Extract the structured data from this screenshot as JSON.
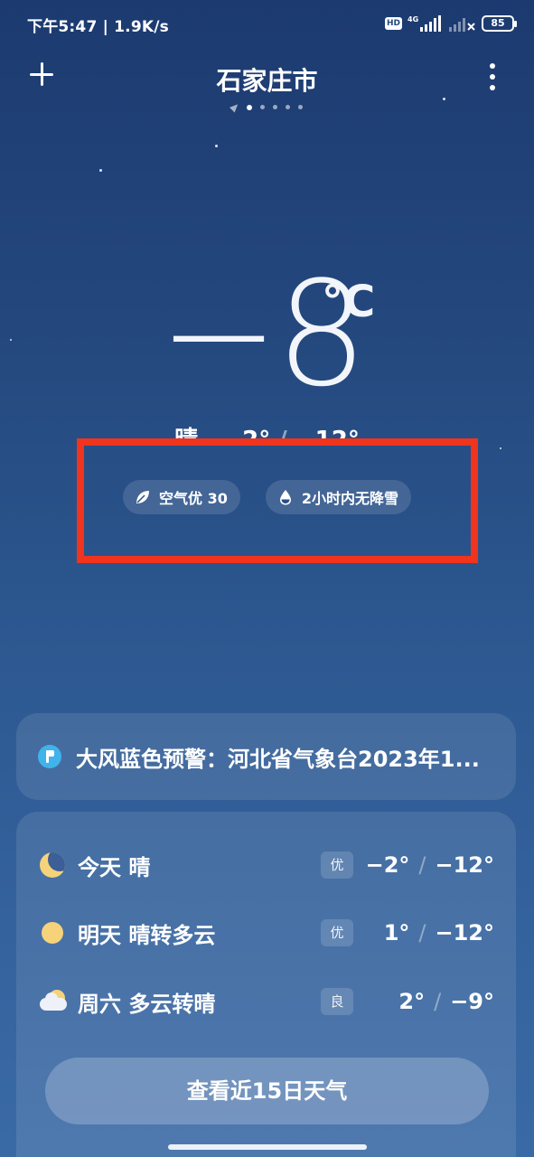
{
  "status_bar": {
    "time_speed": "下午5:47 | 1.9K/s",
    "hd": "HD",
    "network": "4G",
    "battery": "85"
  },
  "header": {
    "city": "石家庄市",
    "page_count": 6,
    "active_page": 1
  },
  "current": {
    "temperature": "−8",
    "unit": "°C",
    "condition": "晴",
    "high": "−2°",
    "separator": "/",
    "low": "−12°"
  },
  "pills": {
    "air_quality": "空气优 30",
    "precipitation": "2小时内无降雪"
  },
  "alert": {
    "text": "大风蓝色预警：河北省气象台2023年1..."
  },
  "forecast": [
    {
      "icon": "moon-icon",
      "label": "今天  晴",
      "aqi": "优",
      "high": "−2°",
      "low": "−12°"
    },
    {
      "icon": "sun-icon",
      "label": "明天  晴转多云",
      "aqi": "优",
      "high": "1°",
      "low": "−12°"
    },
    {
      "icon": "partly-cloudy-icon",
      "label": "周六  多云转晴",
      "aqi": "良",
      "high": "2°",
      "low": "−9°"
    }
  ],
  "cta": {
    "label": "查看近15日天气"
  },
  "colors": {
    "highlight_box": "#f0341d",
    "alert_icon": "#3fb3ea",
    "sun": "#f6d27a"
  }
}
